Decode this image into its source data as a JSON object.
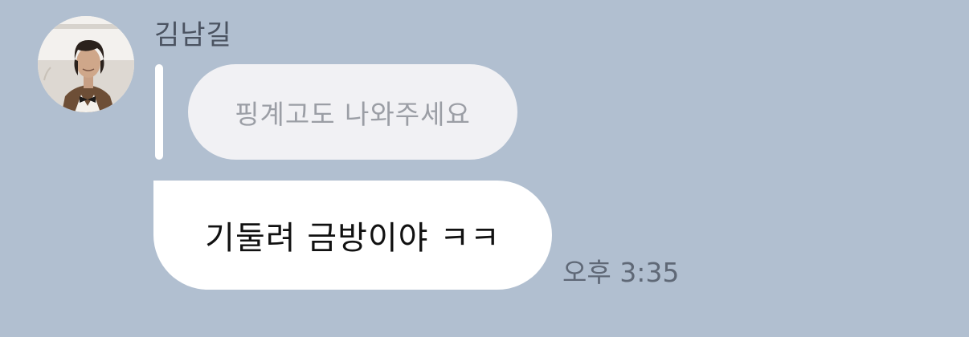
{
  "chat": {
    "sender_name": "김남길",
    "reply_quote": "핑계고도 나와주세요",
    "message": "기둘려 금방이야 ㅋㅋ",
    "time": "오후 3:35"
  },
  "avatar": {
    "description_icon": "profile-photo"
  },
  "colors": {
    "background": "#b1bfd0",
    "bubble": "#ffffff",
    "quote_bubble": "#f1f1f4",
    "quote_text": "#9b9ea5",
    "name_text": "#4b5361",
    "time_text": "#5f6876"
  }
}
